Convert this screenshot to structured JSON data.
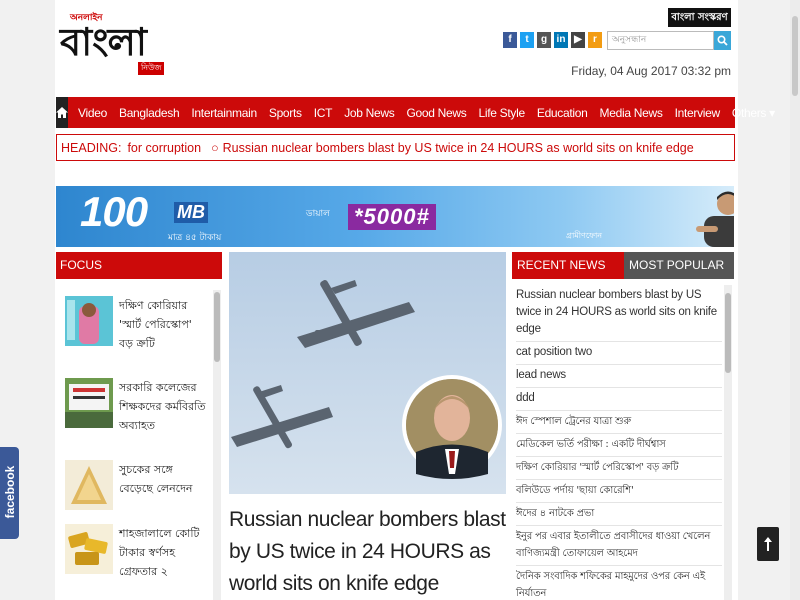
{
  "header": {
    "logo_top": "অনলাইন",
    "logo_main": "বাংলা",
    "logo_tag": "নিউজ",
    "bangla_button": "বাংলা সংস্করণ",
    "search_placeholder": "অনুসন্ধান",
    "datetime": "Friday, 04 Aug 2017 03:32 pm",
    "social": [
      {
        "name": "facebook-icon",
        "label": "f",
        "color": "#3b5998"
      },
      {
        "name": "twitter-icon",
        "label": "t",
        "color": "#1da1f2"
      },
      {
        "name": "google-plus-icon",
        "label": "g",
        "color": "#555555"
      },
      {
        "name": "linkedin-icon",
        "label": "in",
        "color": "#0077b5"
      },
      {
        "name": "youtube-icon",
        "label": "▶",
        "color": "#444444"
      },
      {
        "name": "rss-icon",
        "label": "r",
        "color": "#f39c12"
      }
    ]
  },
  "nav": {
    "items": [
      "Video",
      "Bangladesh",
      "Intertainmain",
      "Sports",
      "ICT",
      "Job News",
      "Good News",
      "Life Style",
      "Education",
      "Media News",
      "Interview",
      "Others ▾"
    ]
  },
  "ticker": {
    "label": "HEADING:",
    "first": "for corruption",
    "second": "Russian nuclear bombers blast by US twice in 24 HOURS as world sits on knife edge"
  },
  "banner": {
    "amount": "100",
    "unit": "MB",
    "price": "মাত্র ৪৫ টাকায়",
    "dial_label": "ডায়াল",
    "code": "*5000#",
    "brand": "গ্রামীণফোন"
  },
  "focus": {
    "header": "FOCUS",
    "items": [
      "দক্ষিণ কোরিয়ার 'স্মার্ট পেরিস্কোপ' বড় ক্রটি",
      "সরকারি কলেজের শিক্ষকদের কর্মবিরতি অব্যাহত",
      "সুচকের সঙ্গে বেড়েছে লেনদেন",
      "শাহজালালে কোটি টাকার স্বর্ণসহ গ্রেফতার ২"
    ]
  },
  "featured": {
    "title": "Russian nuclear bombers blast by US twice in 24 HOURS as world sits on knife edge"
  },
  "sidebar": {
    "tab_recent": "RECENT NEWS",
    "tab_popular": "MOST POPULAR",
    "news": [
      "Russian nuclear bombers blast by US twice in 24 HOURS as world sits on knife edge",
      "cat position two",
      "lead news",
      "ddd",
      "ঈদ স্পেশাল ট্রেনের যাত্রা শুরু",
      "মেডিকেল ভর্তি পরীক্ষা : একটি দীর্ঘশ্বাস",
      "দক্ষিণ কোরিয়ার 'স্মার্ট পেরিস্কোপ' বড় ক্রটি",
      "বলিউডে পর্দায় 'ছায়া কোরেশি'",
      "ঈদের ৪ নাটকে প্রভা",
      "ইনুর পর এবার ইতালীতে প্রবাসীদের ধাওয়া খেলেন বাণিজ্যমন্ত্রী তোফায়েল আহমেদ",
      "দৈনিক সংবাদিক শফিকের মাহমুদের ওপর কেন এই নির্যাতন"
    ]
  },
  "floating": {
    "facebook_tab": "facebook"
  }
}
